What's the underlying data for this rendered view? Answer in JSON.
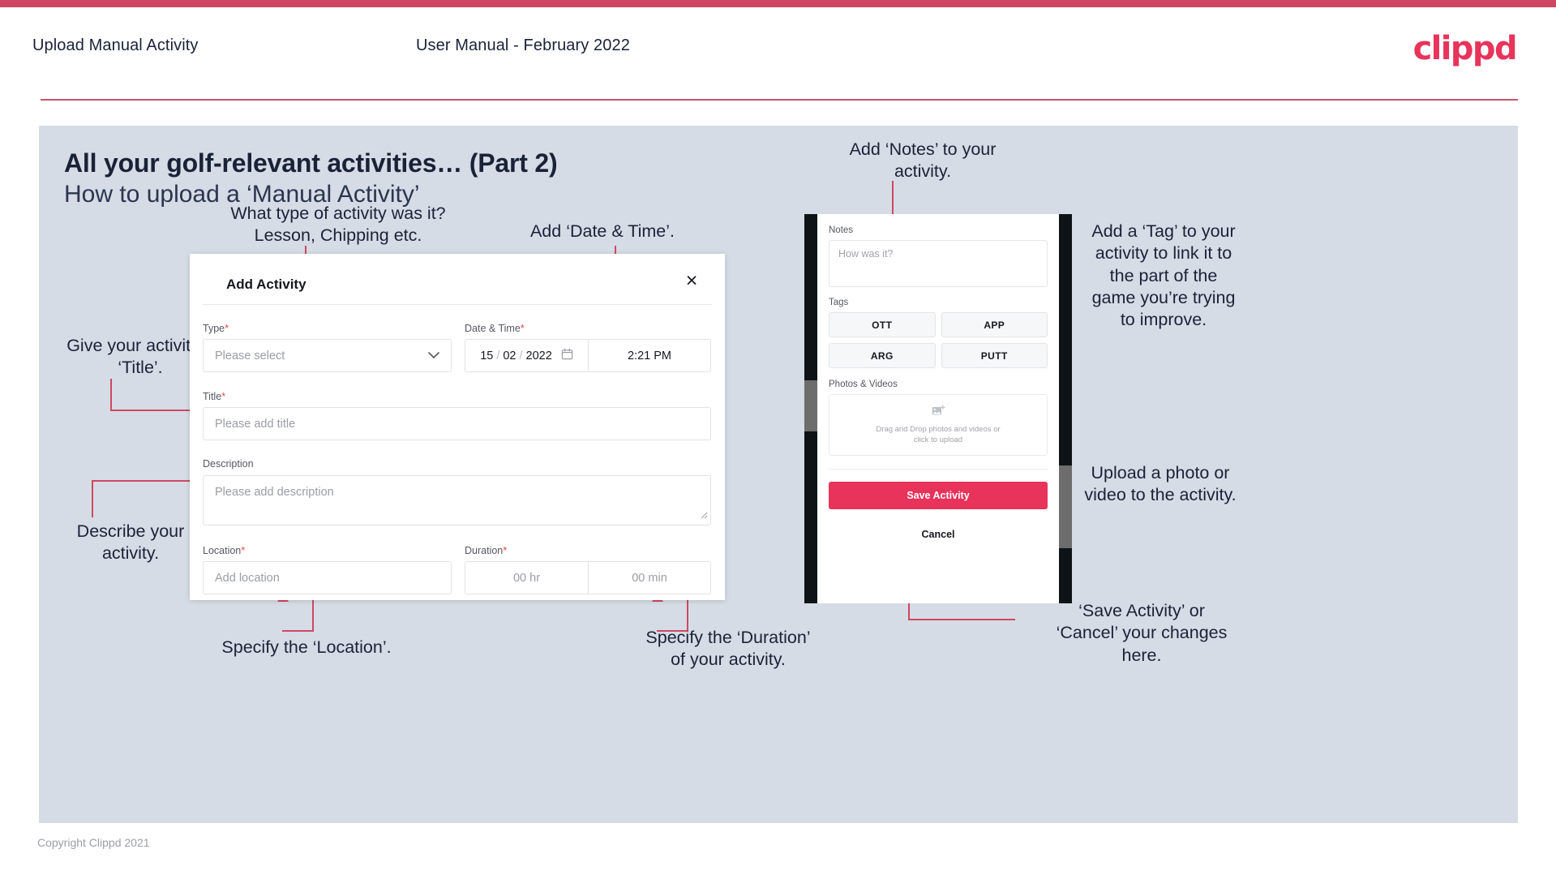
{
  "header": {
    "title": "Upload Manual Activity",
    "subtitle": "User Manual - February 2022",
    "logo": "clippd"
  },
  "slide": {
    "heading": "All your golf-relevant activities… (Part 2)",
    "subheading": "How to upload a ‘Manual Activity’"
  },
  "dialog": {
    "title": "Add Activity",
    "close_icon": "×",
    "type": {
      "label": "Type",
      "required": "*",
      "placeholder": "Please select",
      "chevron": "chevron-down"
    },
    "datetime": {
      "label": "Date & Time",
      "required": "*",
      "day": "15",
      "sep1": "/",
      "month": "02",
      "sep2": "/",
      "year": "2022",
      "time": "2:21 PM"
    },
    "title_field": {
      "label": "Title",
      "required": "*",
      "placeholder": "Please add title"
    },
    "description": {
      "label": "Description",
      "placeholder": "Please add description"
    },
    "location": {
      "label": "Location",
      "required": "*",
      "placeholder": "Add location"
    },
    "duration": {
      "label": "Duration",
      "required": "*",
      "hours": "00 hr",
      "minutes": "00 min"
    }
  },
  "phone": {
    "notes": {
      "label": "Notes",
      "placeholder": "How was it?"
    },
    "tags": {
      "label": "Tags",
      "items": [
        "OTT",
        "APP",
        "ARG",
        "PUTT"
      ]
    },
    "photos": {
      "label": "Photos & Videos",
      "dropzone_line1": "Drag and Drop photos and videos or",
      "dropzone_line2": "click to upload"
    },
    "save_label": "Save Activity",
    "cancel_label": "Cancel"
  },
  "annotations": {
    "type": "What type of activity was it?\nLesson, Chipping etc.",
    "datetime": "Add ‘Date & Time’.",
    "title": "Give your activity a\n‘Title’.",
    "description": "Describe your\nactivity.",
    "location": "Specify the ‘Location’.",
    "duration": "Specify the ‘Duration’\nof your activity.",
    "notes": "Add ‘Notes’ to your\nactivity.",
    "tags": "Add a ‘Tag’ to your\nactivity to link it to\nthe part of the\ngame you’re trying\nto improve.",
    "upload": "Upload a photo or\nvideo to the activity.",
    "save": "‘Save Activity’ or\n‘Cancel’ your changes\nhere."
  },
  "footer": {
    "copyright": "Copyright Clippd 2021"
  },
  "colors": {
    "accent": "#e8335a",
    "rule": "#cf4861",
    "slide_bg": "#d6dce5",
    "ink": "#1a2238"
  }
}
